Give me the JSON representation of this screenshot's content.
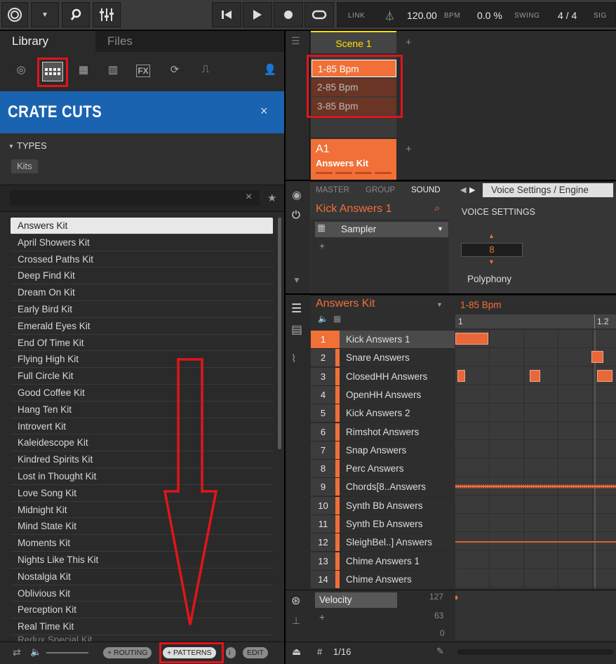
{
  "topbar": {
    "link": "LINK",
    "tempo": "120.00",
    "bpm_unit": "BPM",
    "swing_val": "0.0 %",
    "swing_label": "SWING",
    "sig": "4 / 4",
    "sig_label": "SIG"
  },
  "library": {
    "tab_library": "Library",
    "tab_files": "Files",
    "fx_label": "FX",
    "crate": "CRATE CUTS",
    "close": "×",
    "types_label": "TYPES",
    "types_tag": "Kits",
    "search_clear": "×",
    "star": "★",
    "kits": [
      "Answers Kit",
      "April Showers Kit",
      "Crossed Paths Kit",
      "Deep Find Kit",
      "Dream On Kit",
      "Early Bird Kit",
      "Emerald Eyes Kit",
      "End Of Time Kit",
      "Flying High Kit",
      "Full Circle Kit",
      "Good Coffee Kit",
      "Hang Ten Kit",
      "Introvert Kit",
      "Kaleidescope Kit",
      "Kindred Spirits Kit",
      "Lost in Thought Kit",
      "Love Song Kit",
      "Midnight Kit",
      "Mind State Kit",
      "Moments Kit",
      "Nights Like This Kit",
      "Nostalgia Kit",
      "Oblivious Kit",
      "Perception Kit",
      "Real Time Kit",
      "Redux Special Kit"
    ],
    "footer": {
      "routing": "+ ROUTING",
      "patterns": "+ PATTERNS",
      "info": "i",
      "edit": "EDIT"
    }
  },
  "arranger": {
    "scene": "Scene 1",
    "add": "+",
    "clips": [
      "1-85 Bpm",
      "2-85 Bpm",
      "3-85 Bpm"
    ],
    "group_id": "A1",
    "group_name": "Answers Kit"
  },
  "control": {
    "tabs": [
      "MASTER",
      "GROUP",
      "SOUND"
    ],
    "sound_name": "Kick Answers 1",
    "plugin": "Sampler",
    "page": "Voice Settings / Engine",
    "section": "VOICE SETTINGS",
    "polyphony_value": "8",
    "polyphony_label": "Polyphony"
  },
  "pattern": {
    "kit": "Answers Kit",
    "pattern_name": "1-85 Bpm",
    "ruler1": "1",
    "ruler2": "1.2",
    "sounds": [
      "Kick Answers 1",
      "Snare Answers",
      "ClosedHH Answers",
      "OpenHH Answers",
      "Kick Answers 2",
      "Rimshot Answers",
      "Snap Answers",
      "Perc Answers",
      "Chords[8..Answers",
      "Synth Bb Answers",
      "Synth Eb Answers",
      "SleighBel..] Answers",
      "Chime Answers 1",
      "Chime Answers"
    ],
    "velocity": "Velocity",
    "vmax": "127",
    "vmid": "63",
    "vmin": "0",
    "grid": "1/16"
  },
  "colors": {
    "accent": "#f07038",
    "crate_bg": "#1a63b0",
    "highlight": "#e0151a"
  }
}
